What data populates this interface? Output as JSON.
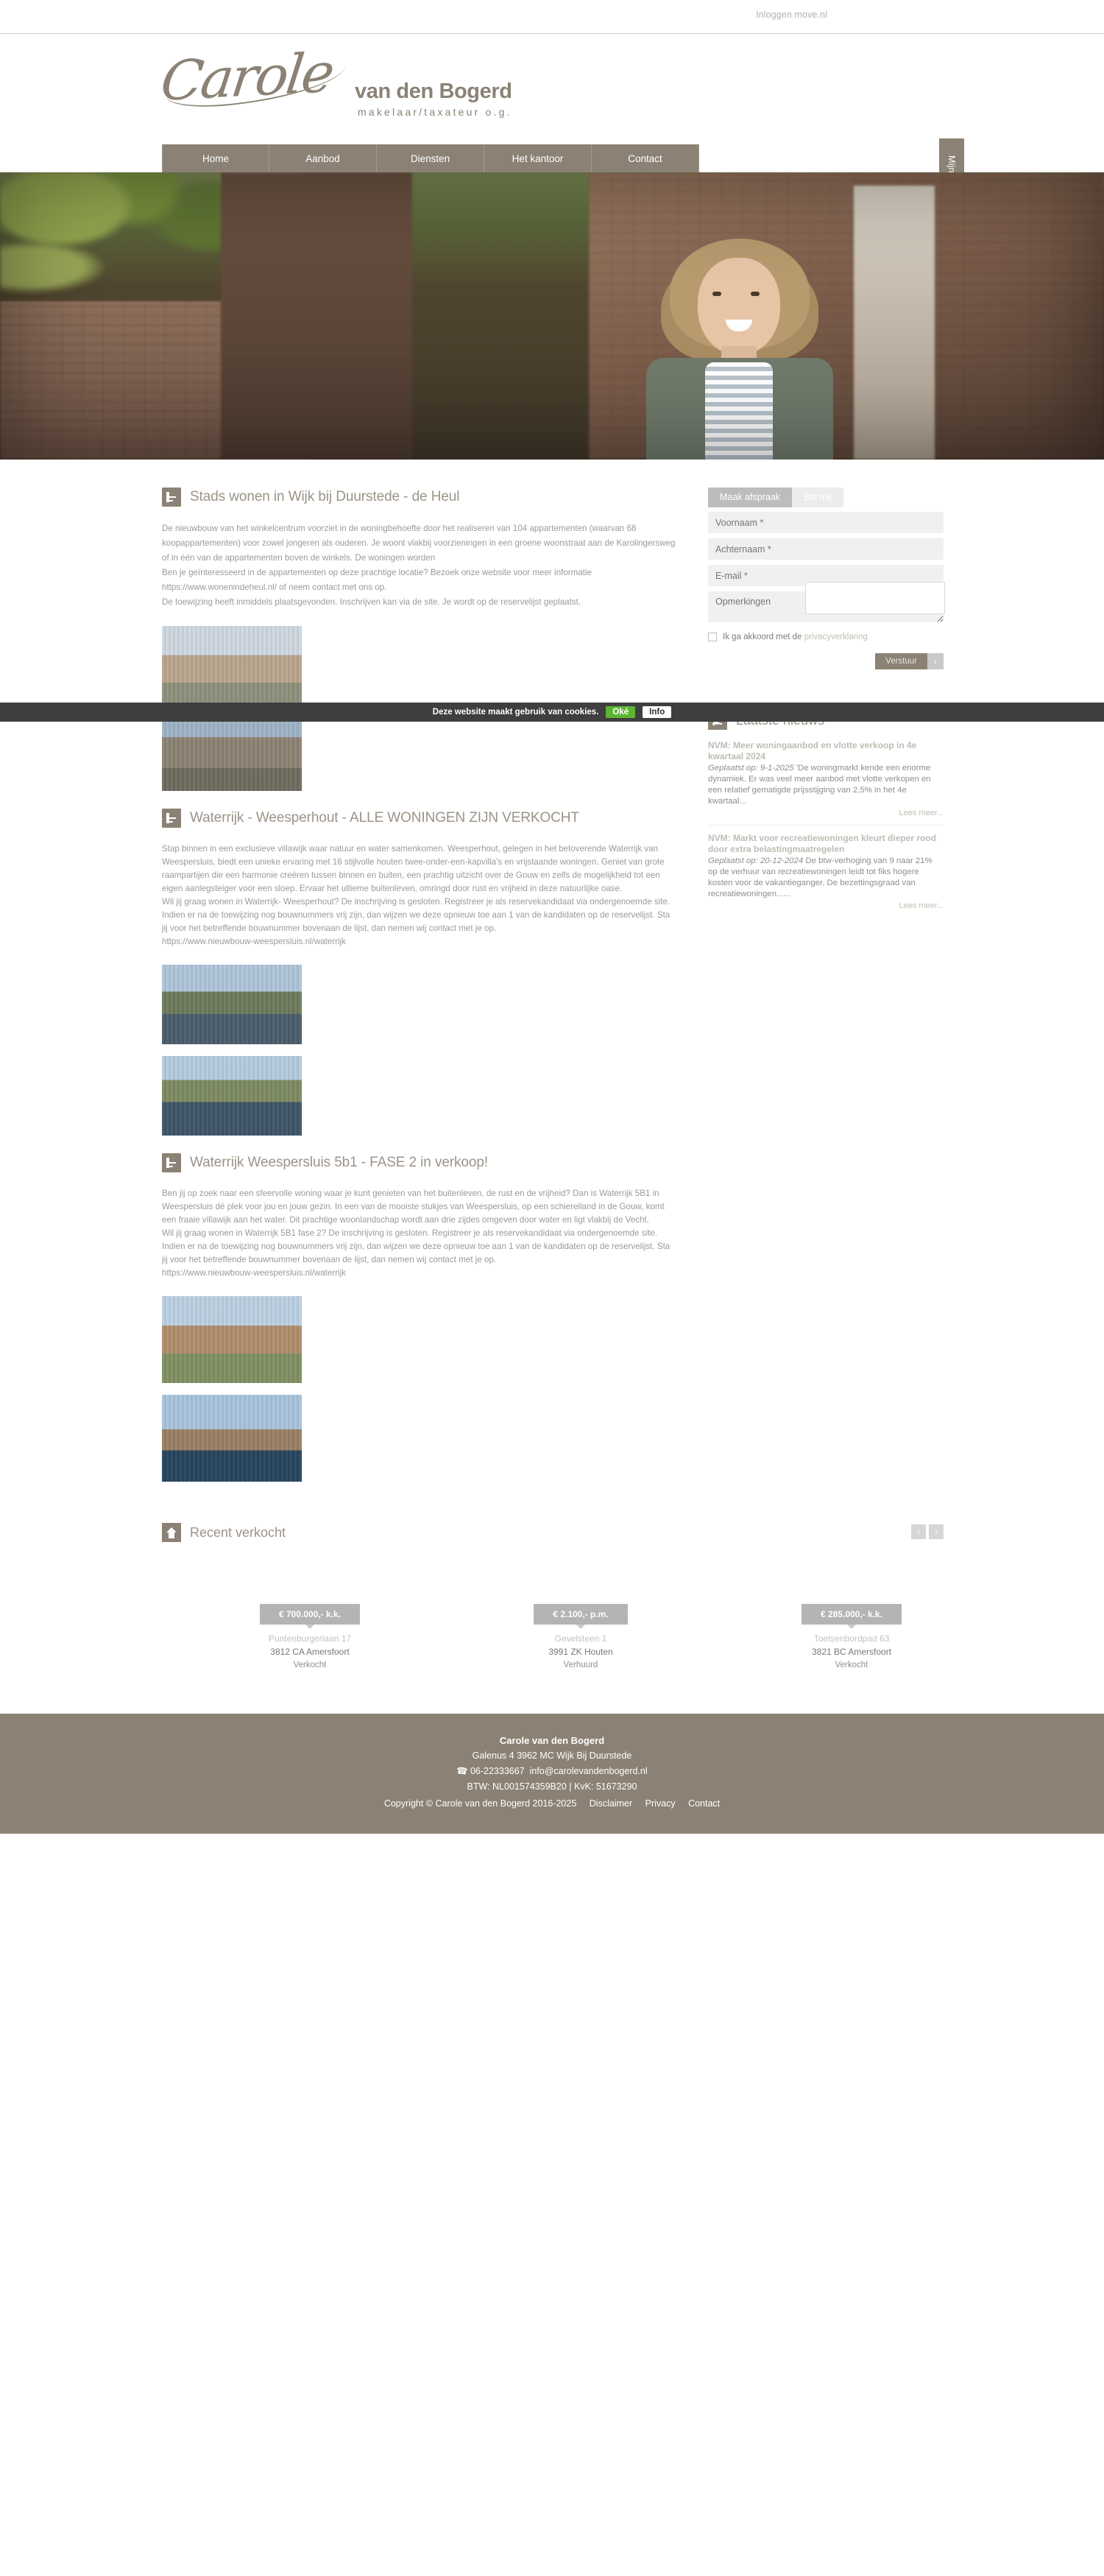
{
  "topbar": {
    "login_label": "Inloggen move.nl"
  },
  "logo": {
    "script": "Carole",
    "name": "van den Bogerd",
    "tagline": "makelaar/taxateur o.g."
  },
  "nav": {
    "items": [
      {
        "label": "Home"
      },
      {
        "label": "Aanbod"
      },
      {
        "label": "Diensten"
      },
      {
        "label": "Het kantoor"
      },
      {
        "label": "Contact"
      }
    ],
    "favorites_label": "Mijn favorieten"
  },
  "cookiebar": {
    "text": "Deze website maakt gebruik van cookies.",
    "ok_label": "Oké",
    "info_label": "Info"
  },
  "articles": [
    {
      "title": "Stads wonen in Wijk bij Duurstede - de Heul",
      "paragraphs": [
        "De nieuwbouw van het winkelcentrum voorziet in de woningbehoefte door het realiseren van 104 appartementen (waarvan 68 koopappartementen) voor zowel jongeren als ouderen. Je woont vlakbij voorzieningen in een groene woonstraat aan de Karolingersweg of in één van de appartementen boven de winkels. De woningen worden",
        "Ben je geïnteresseerd in de appartementen op deze prachtige locatie? Bezoek onze website voor meer informatie https://www.wonenindeheul.nl/ of neem contact met ons op.",
        "De toewijzing heeft inmiddels plaatsgevonden. Inschrijven kan via de site. Je wordt op de reservelijst geplaatst."
      ],
      "images": [
        {
          "alt": "Impressie winkelcentrum de Heul"
        },
        {
          "alt": "Impressie appartementen de Heul"
        }
      ]
    },
    {
      "title": "Waterrijk - Weesperhout - ALLE WONINGEN ZIJN VERKOCHT",
      "paragraphs": [
        "Stap binnen in een exclusieve villawijk waar natuur en water samenkomen. Weesperhout, gelegen in het betoverende Waterrijk van Weespersluis, biedt een unieke ervaring met 16 stijlvolle houten twee-onder-een-kapvilla's en vrijstaande woningen. Geniet van grote raampartijen die een harmonie creëren tussen binnen en buiten, een prachtig uitzicht over de Gouw en zelfs de mogelijkheid tot een eigen aanlegsteiger voor een sloep. Ervaar het ultieme buitenleven, omringd door rust en vrijheid in deze natuurlijke oase.",
        "Wil jij graag wonen in Waterrijk- Weesperhout? De inschrijving is gesloten. Registreer je als reservekandidaat via ondergenoemde site. Indien er na de toewijzing nog bouwnummers vrij zijn, dan wijzen we deze opnieuw toe aan 1 van de kandidaten op de reservelijst. Sta jij voor het betreffende bouwnummer bovenaan de lijst, dan nemen wij contact met je op.",
        "https://www.nieuwbouw-weespersluis.nl/waterrijk"
      ],
      "images": [
        {
          "alt": "Weesperhout villa's aan het water"
        },
        {
          "alt": "Weesperhout woningen met steiger"
        }
      ]
    },
    {
      "title": "Waterrijk Weespersluis 5b1 - FASE 2 in verkoop!",
      "paragraphs": [
        "Ben jij op zoek naar een sfeervolle woning waar je kunt genieten van het buitenleven, de rust en de vrijheid? Dan is Waterrijk 5B1 in Weespersluis dé plek voor jou en jouw gezin. In een van de mooiste stukjes van Weespersluis, op een schiereiland in de Gouw, komt een fraaie villawijk aan het water. Dit prachtige woonlandschap wordt aan drie zijdes omgeven door water en ligt vlakbij de Vecht.",
        "Wil jij graag wonen in Waterrijk 5B1 fase 2? De inschrijving is gesloten. Registreer je als reservekandidaat via ondergenoemde site. Indien er na de toewijzing nog bouwnummers vrij zijn, dan wijzen we deze opnieuw toe aan 1 van de kandidaten op de reservelijst. Sta jij voor het betreffende bouwnummer bovenaan de lijst, dan nemen wij contact met je op.",
        "https://www.nieuwbouw-weespersluis.nl/waterrijk"
      ],
      "images": [
        {
          "alt": "Waterrijk 5B1 straatbeeld"
        },
        {
          "alt": "Waterrijk 5B1 woningen aan het water"
        }
      ]
    }
  ],
  "form": {
    "tabs": [
      {
        "label": "Maak afspraak",
        "active": true
      },
      {
        "label": "Bel mij",
        "active": false
      }
    ],
    "fields": {
      "voornaam": {
        "placeholder": "Voornaam *",
        "value": ""
      },
      "achternaam": {
        "placeholder": "Achternaam *",
        "value": ""
      },
      "email": {
        "placeholder": "E-mail *",
        "value": ""
      },
      "opmerkingen": {
        "placeholder": "Opmerkingen",
        "value": ""
      }
    },
    "consent_prefix": "Ik ga akkoord met de",
    "consent_link": "privacyverklaring",
    "submit_label": "Verstuur",
    "submit_arrow": "›"
  },
  "news": {
    "title": "Laatste nieuws",
    "items": [
      {
        "title": "NVM: Meer woningaanbod en vlotte verkoop in 4e kwartaal 2024",
        "date": "Geplaatst op: 9-1-2025",
        "body": "'De woningmarkt kende een enorme dynamiek. Er was veel meer aanbod met vlotte verkopen en een relatief gematigde prijsstijging van 2,5% in het 4e kwartaal...",
        "more": "Lees meer..."
      },
      {
        "title": "NVM: Markt voor recreatiewoningen kleurt dieper rood door extra belastingmaatregelen",
        "date": "Geplaatst op: 20-12-2024",
        "body": "De btw-verhoging van 9 naar 21% op de verhuur van recreatiewoningen leidt tot fiks hogere kosten voor de vakantieganger. De bezettingsgraad van recreatiewoningen......",
        "more": "Lees meer..."
      }
    ]
  },
  "recent": {
    "title": "Recent verkocht",
    "prev": "‹",
    "next": "›",
    "cards": [
      {
        "price": "€ 700.000,- k.k.",
        "street": "Puntenburgerlaan 17",
        "city": "3812 CA Amersfoort",
        "status": "Verkocht"
      },
      {
        "price": "€ 2.100,- p.m.",
        "street": "Gevelsteen 1",
        "city": "3991 ZK Houten",
        "status": "Verhuurd"
      },
      {
        "price": "€ 285.000,- k.k.",
        "street": "Toetsenbordpad 63",
        "city": "3821 BC Amersfoort",
        "status": "Verkocht"
      }
    ]
  },
  "footer": {
    "name": "Carole van den Bogerd",
    "address": "Galenus 4   3962 MC Wijk Bij Duurstede",
    "phone": "06-22333667",
    "email": "info@carolevandenbogerd.nl",
    "legal": "BTW: NL001574359B20 | KvK: 51673290",
    "copyright": "Copyright © Carole van den Bogerd 2016-2025",
    "links": [
      {
        "label": "Disclaimer"
      },
      {
        "label": "Privacy"
      },
      {
        "label": "Contact"
      }
    ]
  },
  "colors": {
    "brand": "#8b8275",
    "cookie_ok": "#5cb531",
    "tag_grey": "#b4b4b4"
  }
}
